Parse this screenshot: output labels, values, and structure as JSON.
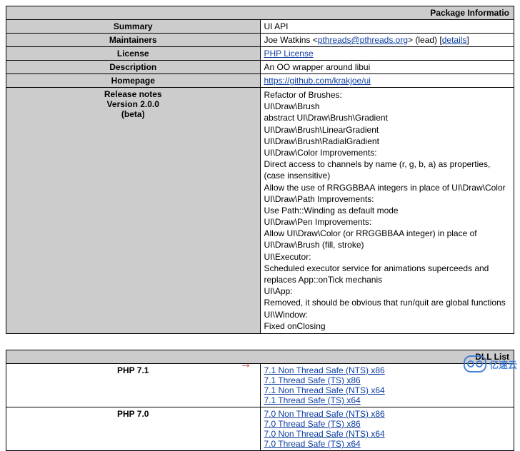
{
  "info": {
    "header": "Package Informatio",
    "rows": {
      "summary_label": "Summary",
      "summary_value": "UI API",
      "maintainers_label": "Maintainers",
      "maintainers_name": "Joe Watkins <",
      "maintainers_email": "pthreads@pthreads.org",
      "maintainers_after": "> (lead) [",
      "maintainers_details": "details",
      "maintainers_close": "]",
      "license_label": "License",
      "license_value": "PHP License",
      "description_label": "Description",
      "description_value": "An OO wrapper around libui",
      "homepage_label": "Homepage",
      "homepage_value": "https://github.com/krakjoe/ui",
      "notes_label_1": "Release notes",
      "notes_label_2": "Version 2.0.0",
      "notes_label_3": "(beta)",
      "notes": [
        "Refactor of Brushes:",
        "UI\\Draw\\Brush",
        "abstract UI\\Draw\\Brush\\Gradient",
        "UI\\Draw\\Brush\\LinearGradient",
        "UI\\Draw\\Brush\\RadialGradient",
        "UI\\Draw\\Color Improvements:",
        "Direct access to channels by name (r, g, b, a) as properties, (case insensitive)",
        "Allow the use of RRGGBBAA integers in place of UI\\Draw\\Color",
        "UI\\Draw\\Path Improvements:",
        "Use Path::Winding as default mode",
        "UI\\Draw\\Pen Improvements:",
        "Allow UI\\Draw\\Color (or RRGGBBAA integer) in place of UI\\Draw\\Brush (fill, stroke)",
        "UI\\Executor:",
        "Scheduled executor service for animations superceeds and replaces App::onTick mechanis",
        "UI\\App:",
        "Removed, it should be obvious that run/quit are global functions",
        "UI\\Window:",
        "Fixed onClosing"
      ]
    }
  },
  "dll": {
    "header": "DLL List",
    "php71_label": "PHP 7.1",
    "php71_links": [
      "7.1 Non Thread Safe (NTS) x86",
      "7.1 Thread Safe (TS) x86",
      "7.1 Non Thread Safe (NTS) x64",
      "7.1 Thread Safe (TS) x64"
    ],
    "php70_label": "PHP 7.0",
    "php70_links": [
      "7.0 Non Thread Safe (NTS) x86",
      "7.0 Thread Safe (TS) x86",
      "7.0 Non Thread Safe (NTS) x64",
      "7.0 Thread Safe (TS) x64"
    ]
  },
  "watermark": "亿速云",
  "arrow_glyph": "→"
}
